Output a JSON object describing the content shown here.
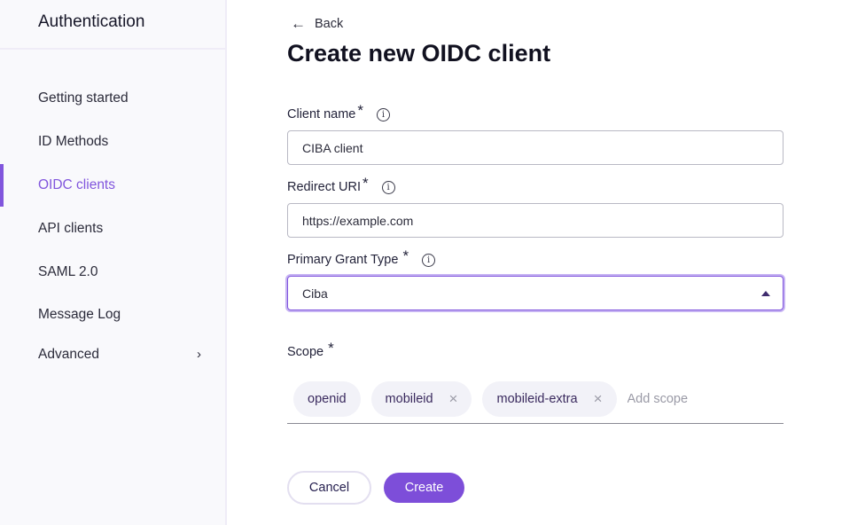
{
  "sidebar": {
    "title": "Authentication",
    "items": [
      {
        "label": "Getting started",
        "active": false
      },
      {
        "label": "ID Methods",
        "active": false
      },
      {
        "label": "OIDC clients",
        "active": true
      },
      {
        "label": "API clients",
        "active": false
      },
      {
        "label": "SAML 2.0",
        "active": false
      },
      {
        "label": "Message Log",
        "active": false
      },
      {
        "label": "Advanced",
        "active": false,
        "has_submenu": true
      }
    ],
    "chevron": "›"
  },
  "main": {
    "back_icon": "←",
    "back_label": "Back",
    "title": "Create new OIDC client",
    "required_marker": "*",
    "info_icon": "i",
    "fields": {
      "client_name": {
        "label": "Client name",
        "value": "CIBA client"
      },
      "redirect_uri": {
        "label": "Redirect URI",
        "value": "https://example.com"
      },
      "grant_type": {
        "label": "Primary Grant Type",
        "value": "Ciba"
      },
      "scope": {
        "label": "Scope",
        "chips": [
          {
            "label": "openid",
            "removable": false
          },
          {
            "label": "mobileid",
            "removable": true
          },
          {
            "label": "mobileid-extra",
            "removable": true
          }
        ],
        "remove_icon": "×",
        "placeholder": "Add scope"
      }
    },
    "actions": {
      "cancel_label": "Cancel",
      "create_label": "Create"
    }
  },
  "colors": {
    "accent": "#8156dd",
    "primary_button": "#7d4ed9",
    "sidebar_bg": "#f9f9fc"
  }
}
